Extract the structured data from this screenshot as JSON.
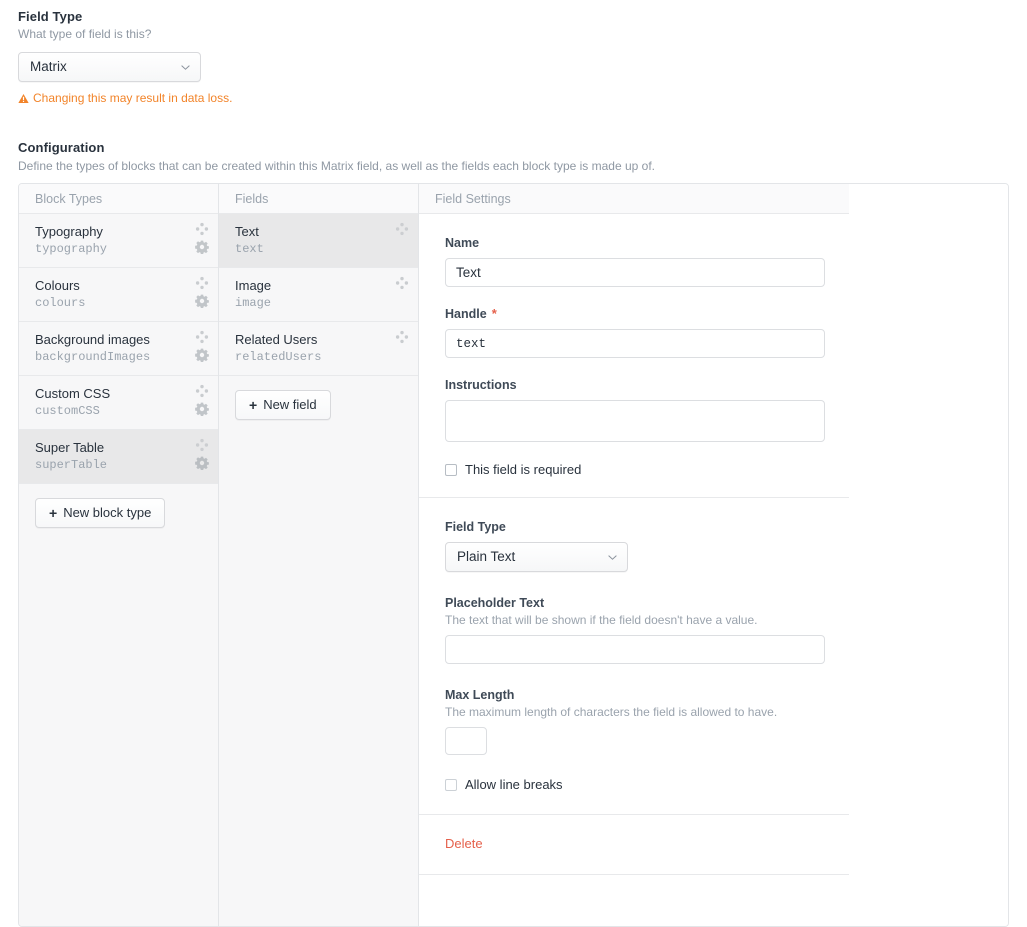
{
  "field_type_section": {
    "heading": "Field Type",
    "description": "What type of field is this?",
    "selected": "Matrix",
    "options": [
      "Matrix"
    ],
    "warning": "Changing this may result in data loss."
  },
  "configuration_section": {
    "heading": "Configuration",
    "description": "Define the types of blocks that can be created within this Matrix field, as well as the fields each block type is made up of."
  },
  "block_types": {
    "column_header": "Block Types",
    "items": [
      {
        "name": "Typography",
        "handle": "typography",
        "selected": false
      },
      {
        "name": "Colours",
        "handle": "colours",
        "selected": false
      },
      {
        "name": "Background images",
        "handle": "backgroundImages",
        "selected": false
      },
      {
        "name": "Custom CSS",
        "handle": "customCSS",
        "selected": false
      },
      {
        "name": "Super Table",
        "handle": "superTable",
        "selected": true
      }
    ],
    "add_button": "New block type"
  },
  "fields": {
    "column_header": "Fields",
    "items": [
      {
        "name": "Text",
        "handle": "text",
        "selected": true
      },
      {
        "name": "Image",
        "handle": "image",
        "selected": false
      },
      {
        "name": "Related Users",
        "handle": "relatedUsers",
        "selected": false
      }
    ],
    "add_button": "New field"
  },
  "field_settings": {
    "column_header": "Field Settings",
    "name": {
      "label": "Name",
      "value": "Text"
    },
    "handle": {
      "label": "Handle",
      "required_marker": "*",
      "value": "text"
    },
    "instructions": {
      "label": "Instructions",
      "value": ""
    },
    "required_checkbox": {
      "label": "This field is required",
      "checked": false
    },
    "field_type": {
      "label": "Field Type",
      "selected": "Plain Text",
      "options": [
        "Plain Text"
      ]
    },
    "placeholder_text": {
      "label": "Placeholder Text",
      "instructions": "The text that will be shown if the field doesn't have a value.",
      "value": ""
    },
    "max_length": {
      "label": "Max Length",
      "instructions": "The maximum length of characters the field is allowed to have.",
      "value": ""
    },
    "line_breaks_checkbox": {
      "label": "Allow line breaks",
      "checked": false
    },
    "delete_link": "Delete"
  },
  "colors": {
    "warning": "#f2842a",
    "danger": "#e5604b",
    "text": "#29323d",
    "muted": "#9aa3ad",
    "selected_row": "#e8e8e9"
  }
}
